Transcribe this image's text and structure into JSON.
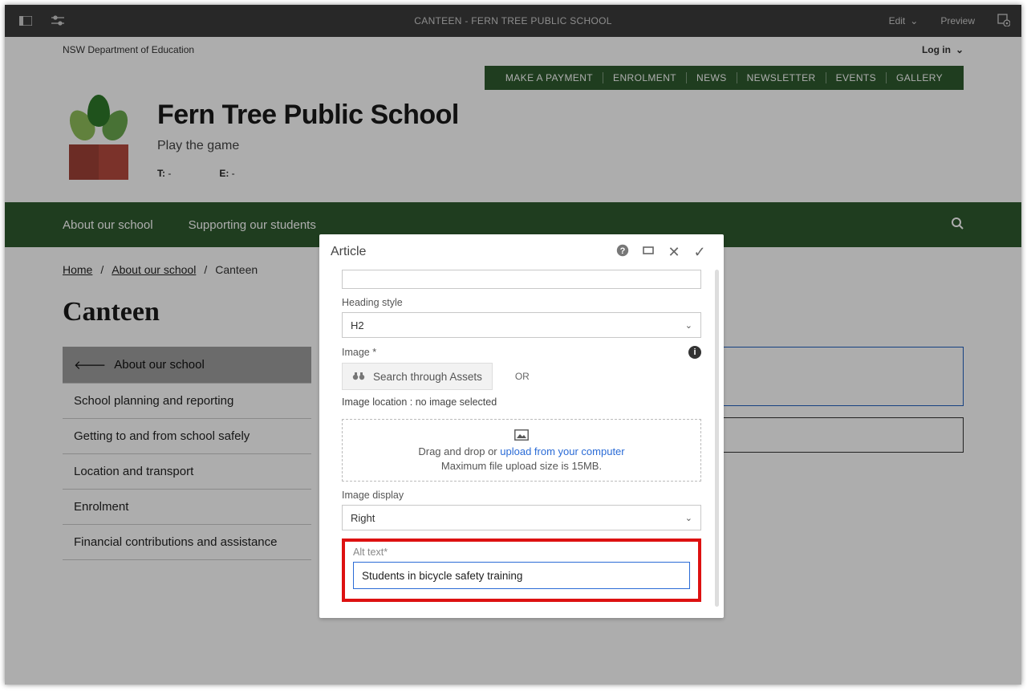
{
  "cms": {
    "title": "CANTEEN - FERN TREE PUBLIC SCHOOL",
    "edit": "Edit",
    "preview": "Preview"
  },
  "dept": {
    "name": "NSW Department of Education",
    "login": "Log in"
  },
  "quick": [
    "MAKE A PAYMENT",
    "ENROLMENT",
    "NEWS",
    "NEWSLETTER",
    "EVENTS",
    "GALLERY"
  ],
  "school": {
    "name": "Fern Tree Public School",
    "tag": "Play the game",
    "tel_label": "T:",
    "tel": " -",
    "email_label": "E:",
    "email": " -"
  },
  "nav": [
    "About our school",
    "Supporting our students"
  ],
  "crumbs": {
    "home": "Home",
    "sec": "About our school",
    "page": "Canteen"
  },
  "h1": "Canteen",
  "side": [
    "About our school",
    "School planning and reporting",
    "Getting to and from school safely",
    "Location and transport",
    "Enrolment",
    "Financial contributions and assistance"
  ],
  "modal": {
    "title": "Article",
    "heading_style_label": "Heading style",
    "heading_style_value": "H2",
    "image_label": "Image *",
    "search_assets": "Search through Assets",
    "or": "OR",
    "location": "Image location : no image selected",
    "drop1a": "Drag and drop or ",
    "drop1b": "upload from your computer",
    "drop2": "Maximum file upload size is 15MB.",
    "display_label": "Image display",
    "display_value": "Right",
    "alt_label": "Alt text*",
    "alt_value": "Students in bicycle safety training"
  }
}
